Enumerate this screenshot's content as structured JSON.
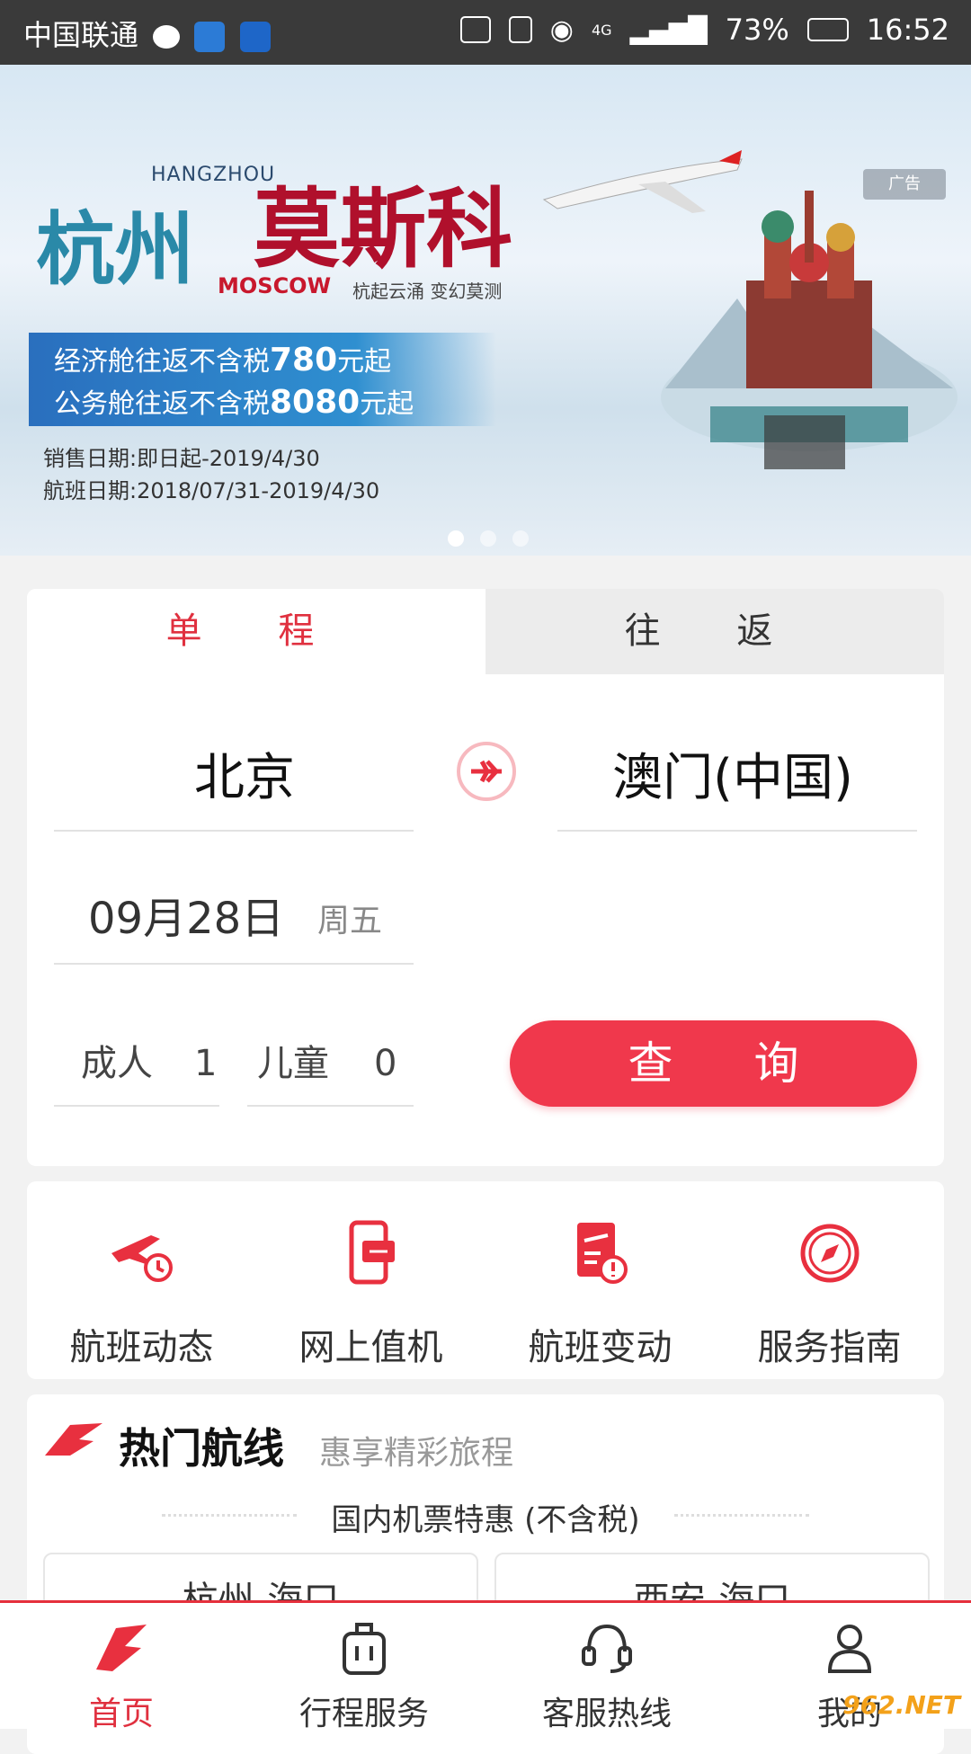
{
  "status_bar": {
    "carrier": "中国联通",
    "network": "4G",
    "battery": "73%",
    "time": "16:52"
  },
  "banner": {
    "city_from_en": "HANGZHOU",
    "city_from_cn": "杭州",
    "city_to_cn": "莫斯科",
    "city_to_en": "MOSCOW",
    "slogan": "杭起云涌 变幻莫测",
    "ad_badge": "广告",
    "price_economy": "经济舱往返不含税",
    "price_economy_value": "780",
    "price_economy_suffix": "元起",
    "price_business": "公务舱往返不含税",
    "price_business_value": "8080",
    "price_business_suffix": "元起",
    "sale_date": "销售日期:即日起-2019/4/30",
    "flight_date": "航班日期:2018/07/31-2019/4/30",
    "active_slide": 1,
    "slide_count": 3
  },
  "booking": {
    "tabs": [
      "单 程",
      "往 返"
    ],
    "active_tab": 0,
    "from_city": "北京",
    "to_city": "澳门(中国)",
    "date": "09月28日",
    "weekday": "周五",
    "adult_label": "成人",
    "adult_count": "1",
    "child_label": "儿童",
    "child_count": "0",
    "search_label": "查询"
  },
  "services": [
    {
      "label": "航班动态",
      "icon": "flight-status-icon"
    },
    {
      "label": "网上值机",
      "icon": "online-checkin-icon"
    },
    {
      "label": "航班变动",
      "icon": "flight-change-icon"
    },
    {
      "label": "服务指南",
      "icon": "compass-icon"
    }
  ],
  "hot_routes": {
    "title": "热门航线",
    "subtitle": "惠享精彩旅程",
    "section": "国内机票特惠 (不含税)",
    "routes": [
      "杭州-海口",
      "西安-海口"
    ]
  },
  "bottom_nav": [
    {
      "label": "首页",
      "icon": "home-logo-icon",
      "active": true
    },
    {
      "label": "行程服务",
      "icon": "luggage-icon",
      "active": false
    },
    {
      "label": "客服热线",
      "icon": "headset-icon",
      "active": false
    },
    {
      "label": "我的",
      "icon": "user-icon",
      "active": false
    }
  ],
  "watermark": "962.NET",
  "colors": {
    "accent": "#f0384c",
    "accent_text": "#e0303f"
  }
}
